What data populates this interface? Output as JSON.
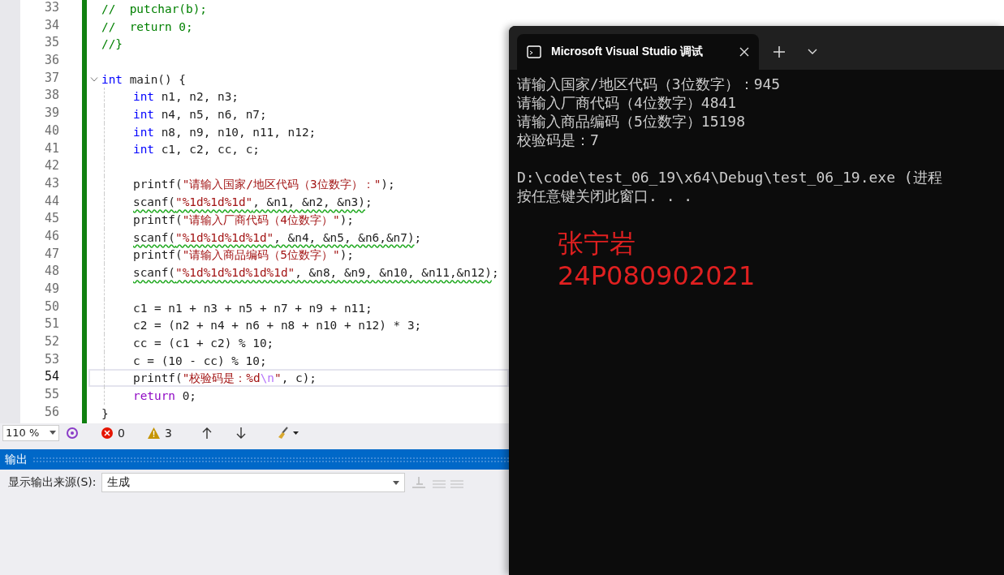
{
  "editor": {
    "lines": [
      {
        "number": "33",
        "current": false,
        "warning": false,
        "segments": [
          {
            "kind": "comment",
            "text": "//  putchar(b);"
          }
        ]
      },
      {
        "number": "34",
        "current": false,
        "warning": false,
        "segments": [
          {
            "kind": "comment",
            "text": "//  return 0;"
          }
        ]
      },
      {
        "number": "35",
        "current": false,
        "warning": false,
        "segments": [
          {
            "kind": "comment",
            "text": "//}"
          }
        ]
      },
      {
        "number": "36",
        "current": false
      },
      {
        "number": "37",
        "current": false,
        "warning": false,
        "segments": [
          {
            "kind": "keyword",
            "text": "int"
          },
          {
            "kind": "text",
            "text": " main() {"
          }
        ],
        "children": [
          {
            "number": "38",
            "current": false,
            "warning": false,
            "segments": [
              {
                "kind": "keyword",
                "text": "int"
              },
              {
                "kind": "text",
                "text": " n1, n2, n3;"
              }
            ]
          },
          {
            "number": "39",
            "current": false,
            "warning": false,
            "segments": [
              {
                "kind": "keyword",
                "text": "int"
              },
              {
                "kind": "text",
                "text": " n4, n5, n6, n7;"
              }
            ]
          },
          {
            "number": "40",
            "current": false,
            "warning": false,
            "segments": [
              {
                "kind": "keyword",
                "text": "int"
              },
              {
                "kind": "text",
                "text": " n8, n9, n10, n11, n12;"
              }
            ]
          },
          {
            "number": "41",
            "current": false,
            "warning": false,
            "segments": [
              {
                "kind": "keyword",
                "text": "int"
              },
              {
                "kind": "text",
                "text": " c1, c2, cc, c;"
              }
            ]
          },
          {
            "number": "42",
            "current": false
          },
          {
            "number": "43",
            "current": false,
            "warning": false,
            "segments": [
              {
                "kind": "text",
                "text": "printf("
              },
              {
                "kind": "string",
                "text": "\"请输入国家/地区代码（3位数字）：\""
              },
              {
                "kind": "text",
                "text": ");"
              }
            ]
          },
          {
            "number": "44",
            "current": false,
            "warning": true,
            "segments": [
              {
                "kind": "text",
                "text": "scanf("
              },
              {
                "kind": "string",
                "text": "\"%1d%1d%1d\""
              },
              {
                "kind": "text",
                "text": ", &n1, &n2, &n3)"
              },
              {
                "kind": "text",
                "text": ";"
              }
            ]
          },
          {
            "number": "45",
            "current": false,
            "warning": false,
            "segments": [
              {
                "kind": "text",
                "text": "printf("
              },
              {
                "kind": "string",
                "text": "\"请输入厂商代码（4位数字）\""
              },
              {
                "kind": "text",
                "text": ");"
              }
            ]
          },
          {
            "number": "46",
            "current": false,
            "warning": true,
            "segments": [
              {
                "kind": "text",
                "text": "scanf("
              },
              {
                "kind": "string",
                "text": "\"%1d%1d%1d%1d\""
              },
              {
                "kind": "text",
                "text": ", &n4, &n5, &n6,&n7)"
              },
              {
                "kind": "text",
                "text": ";"
              }
            ]
          },
          {
            "number": "47",
            "current": false,
            "warning": false,
            "segments": [
              {
                "kind": "text",
                "text": "printf("
              },
              {
                "kind": "string",
                "text": "\"请输入商品编码（5位数字）\""
              },
              {
                "kind": "text",
                "text": ");"
              }
            ]
          },
          {
            "number": "48",
            "current": false,
            "warning": true,
            "segments": [
              {
                "kind": "text",
                "text": "scanf("
              },
              {
                "kind": "string",
                "text": "\"%1d%1d%1d%1d%1d\""
              },
              {
                "kind": "text",
                "text": ", &n8, &n9, &n10, &n11,&n12)"
              },
              {
                "kind": "text",
                "text": ";"
              }
            ]
          },
          {
            "number": "49",
            "current": false
          },
          {
            "number": "50",
            "current": false,
            "warning": false,
            "segments": [
              {
                "kind": "text",
                "text": "c1 = n1 + n3 + n5 + n7 + n9 + n11;"
              }
            ]
          },
          {
            "number": "51",
            "current": false,
            "warning": false,
            "segments": [
              {
                "kind": "text",
                "text": "c2 = (n2 + n4 + n6 + n8 + n10 + n12) * 3;"
              }
            ]
          },
          {
            "number": "52",
            "current": false,
            "warning": false,
            "segments": [
              {
                "kind": "text",
                "text": "cc = (c1 + c2) % 10;"
              }
            ]
          },
          {
            "number": "53",
            "current": false,
            "warning": false,
            "segments": [
              {
                "kind": "text",
                "text": "c = (10 - cc) % 10;"
              }
            ]
          },
          {
            "number": "54",
            "current": true,
            "warning": false,
            "segments": [
              {
                "kind": "text",
                "text": "printf("
              },
              {
                "kind": "string",
                "text": "\"校验码是：%d"
              },
              {
                "kind": "escape",
                "text": "\\n"
              },
              {
                "kind": "string",
                "text": "\""
              },
              {
                "kind": "text",
                "text": ", c);"
              }
            ]
          },
          {
            "number": "55",
            "current": false,
            "warning": false,
            "segments": [
              {
                "kind": "control",
                "text": "return"
              },
              {
                "kind": "text",
                "text": " 0;"
              }
            ]
          }
        ]
      },
      {
        "number": "56",
        "current": false,
        "warning": false,
        "segments": [
          {
            "kind": "text",
            "text": "}"
          }
        ]
      }
    ]
  },
  "status_toolbar": {
    "zoom": "110 %",
    "errors": "0",
    "warnings": "3"
  },
  "output_panel": {
    "title": "输出",
    "source_label": "显示输出来源(S):",
    "source_value": "生成"
  },
  "terminal": {
    "tab_title": "Microsoft Visual Studio 调试",
    "output_lines": [
      "请输入国家/地区代码（3位数字）：945",
      "请输入厂商代码（4位数字）4841",
      "请输入商品编码（5位数字）15198",
      "校验码是：7"
    ],
    "exit_lines": [
      "D:\\code\\test_06_19\\x64\\Debug\\test_06_19.exe (进程",
      "按任意键关闭此窗口. . ."
    ]
  },
  "annotation": [
    "张宁岩",
    "24P080902021"
  ]
}
